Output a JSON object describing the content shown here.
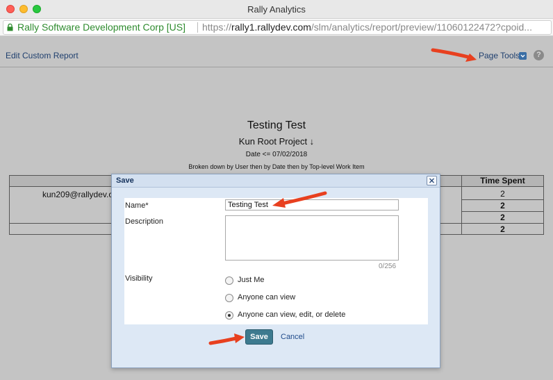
{
  "window": {
    "title": "Rally Analytics"
  },
  "address_bar": {
    "organization": "Rally Software Development Corp [US]",
    "url_scheme": "https://",
    "url_host": "rally1.rallydev.com",
    "url_path": "/slm/analytics/report/preview/11060122472?cpoid..."
  },
  "toolbar": {
    "edit_label": "Edit Custom Report",
    "page_tools_label": "Page Tools",
    "help_symbol": "?"
  },
  "report": {
    "title": "Testing Test",
    "project": "Kun Root Project ↓",
    "date_filter": "Date <= 07/02/2018",
    "breakdown": "Broken down by User then by Date then by Top-level Work Item",
    "time_spent_header": "Time Spent",
    "user": "kun209@rallydev.c",
    "time_values": [
      "2",
      "2",
      "2",
      "2"
    ]
  },
  "dialog": {
    "title": "Save",
    "name_label": "Name*",
    "name_value": "Testing Test",
    "description_label": "Description",
    "description_counter": "0/256",
    "visibility_label": "Visibility",
    "visibility_options": [
      "Just Me",
      "Anyone can view",
      "Anyone can view, edit, or delete"
    ],
    "visibility_selected": "Anyone can view, edit, or delete",
    "save_label": "Save",
    "cancel_label": "Cancel"
  },
  "colors": {
    "annotation_arrow": "#e8401f",
    "save_button": "#3d7a8f",
    "link": "#1f3f6e"
  }
}
